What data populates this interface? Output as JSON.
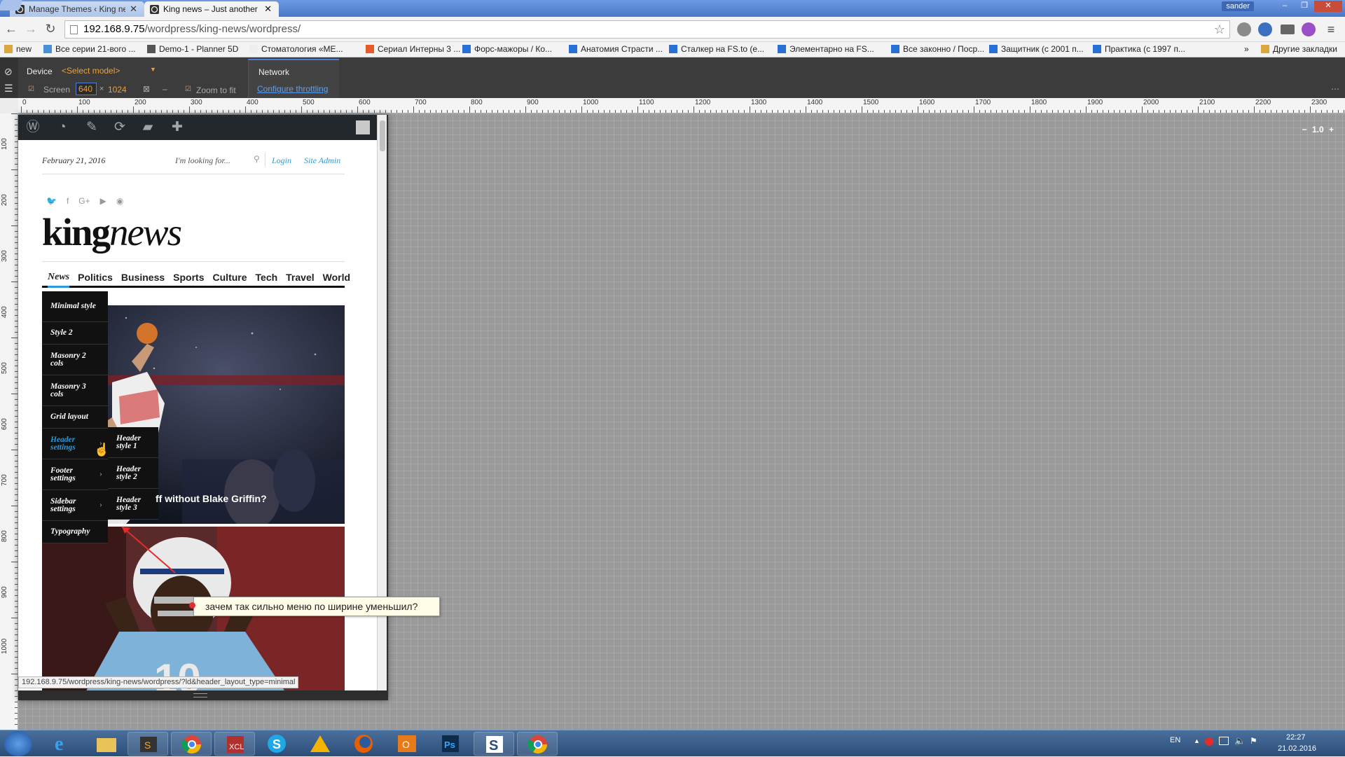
{
  "browser": {
    "tabs": [
      {
        "title": "Manage Themes ‹ King ne"
      },
      {
        "title": "King news – Just another V"
      }
    ],
    "user": "sander",
    "window_controls": {
      "minimize": "–",
      "restore": "❐",
      "close": "✕"
    },
    "url_host": "192.168.9.75",
    "url_path": "/wordpress/king-news/wordpress/",
    "bookmarks": [
      "new",
      "Все серии 21-вого ...",
      "Demo-1 - Planner 5D",
      "Стоматология «МЕ...",
      "Сериал Интерны 3 ...",
      "Форс-мажоры / Ко...",
      "Анатомия Страсти ...",
      "Сталкер на FS.to (е...",
      "Элементарно на FS...",
      "Все законно / Поср...",
      "Защитник (с 2001 п...",
      "Практика (с 1997 п..."
    ],
    "bookmarks_more": "»",
    "other_bookmarks": "Другие закладки"
  },
  "devtools": {
    "device_label": "Device",
    "model_select": "<Select model>",
    "screen_label": "Screen",
    "screen_width": "640",
    "screen_x": "×",
    "screen_height": "1024",
    "zoom_label": "Zoom to fit",
    "network_label": "Network",
    "throttling_link": "Configure throttling",
    "zoom_value": "1.0",
    "ruler_h": [
      "0",
      "100",
      "200",
      "300",
      "400",
      "500",
      "600",
      "700",
      "800",
      "900",
      "1000",
      "1100",
      "1200",
      "1300",
      "1400",
      "1500",
      "1600",
      "1700",
      "1800",
      "1900",
      "2000",
      "2100",
      "2200",
      "2300"
    ],
    "ruler_v": [
      "100",
      "200",
      "300",
      "400",
      "500",
      "600",
      "700",
      "800",
      "900",
      "1000"
    ]
  },
  "site": {
    "date": "February 21, 2016",
    "search_placeholder": "I'm looking for...",
    "login": "Login",
    "site_admin": "Site Admin",
    "social": [
      "twitter-icon",
      "facebook-icon",
      "google-plus-icon",
      "youtube-icon",
      "rss-icon"
    ],
    "social_glyphs": [
      "🐦",
      "f",
      "G+",
      "▶",
      "◉"
    ],
    "logo_king": "king",
    "logo_news": "news",
    "nav": [
      "News",
      "Politics",
      "Business",
      "Sports",
      "Culture",
      "Tech",
      "Travel",
      "World"
    ],
    "dropdown": [
      "Minimal style",
      "Style 2",
      "Masonry 2 cols",
      "Masonry 3 cols",
      "Grid layout",
      "Header settings",
      "Footer settings",
      "Sidebar settings",
      "Typography"
    ],
    "submenu": [
      "Header style 1",
      "Header style 2",
      "Header style 3"
    ],
    "hero_caption": "ff without Blake Griffin?",
    "accent": "#2a9ad8"
  },
  "status_url": "192.168.9.75/wordpress/king-news/wordpress/?ld&header_layout_type=minimal",
  "annotation": "зачем так сильно меню по ширине уменьшил?",
  "taskbar": {
    "lang": "EN",
    "time": "22:27",
    "date": "21.02.2016"
  }
}
